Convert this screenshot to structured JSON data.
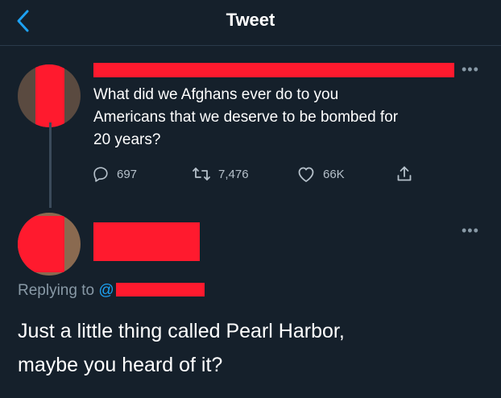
{
  "header": {
    "title": "Tweet",
    "back_icon": "chevron-left-icon"
  },
  "colors": {
    "background": "#15202b",
    "accent": "#1da1f2",
    "muted_text": "#8899a6",
    "redaction": "#ff1a2e"
  },
  "original_tweet": {
    "text": "What did we Afghans ever do to you\nAmericans that we deserve to be bombed for\n20 years?",
    "more": "•••",
    "actions": {
      "reply_count": "697",
      "retweet_count": "7,476",
      "like_count": "66K"
    }
  },
  "reply_tweet": {
    "more": "•••",
    "replying_to_label": "Replying to",
    "replying_to_prefix": "@",
    "text": "Just a little thing called Pearl Harbor,\nmaybe you heard of it?"
  }
}
